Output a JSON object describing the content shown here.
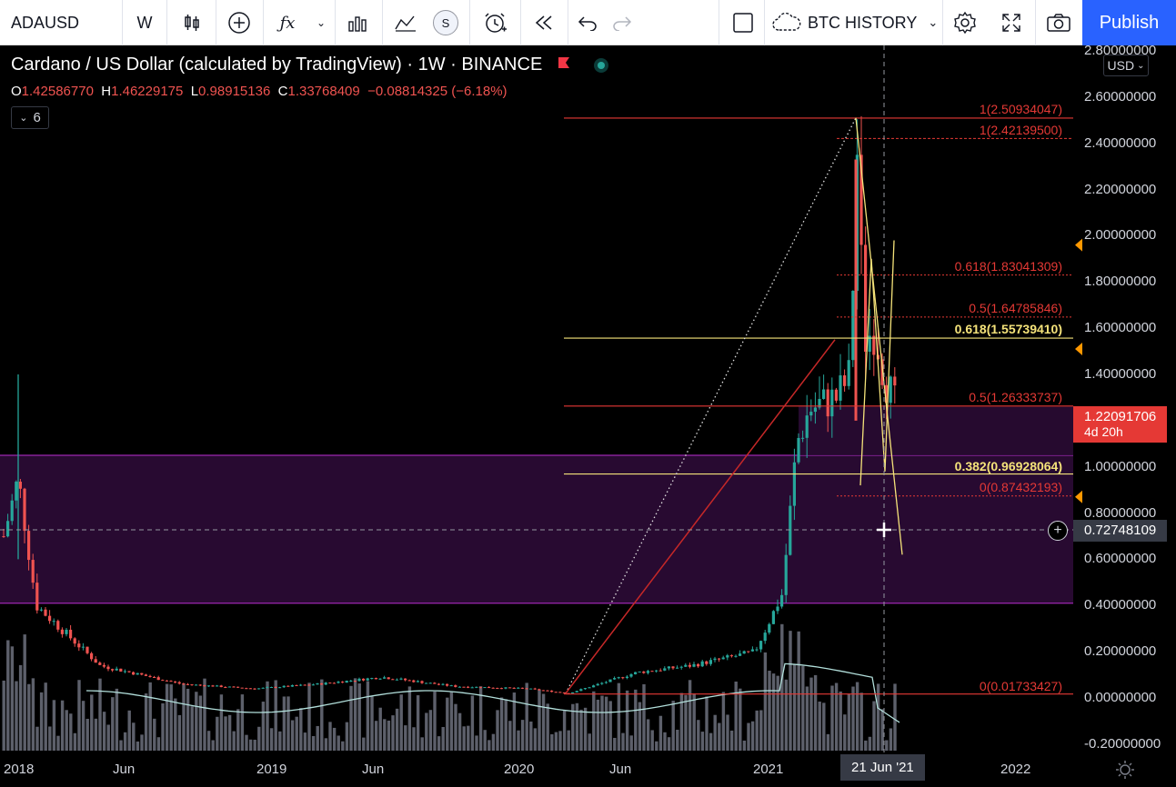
{
  "toolbar": {
    "symbol": "ADAUSD",
    "interval": "W",
    "indicator_fx": "ƒx",
    "replay_s": "S",
    "layout_name": "BTC HISTORY",
    "publish_label": "Publish"
  },
  "legend": {
    "title": "Cardano / US Dollar (calculated by TradingView) · 1W · BINANCE",
    "o_key": "O",
    "o": "1.42586770",
    "h_key": "H",
    "h": "1.46229175",
    "l_key": "L",
    "l": "0.98915136",
    "c_key": "C",
    "c": "1.33768409",
    "change": "−0.08814325 (−6.18%)",
    "indicators_count": "6"
  },
  "price_axis": {
    "currency": "USD",
    "ticks": [
      "2.80000000",
      "2.60000000",
      "2.40000000",
      "2.20000000",
      "2.00000000",
      "1.80000000",
      "1.60000000",
      "1.40000000",
      "1.20000000",
      "1.00000000",
      "0.80000000",
      "0.60000000",
      "0.40000000",
      "0.20000000",
      "0.00000000",
      "-0.20000000"
    ],
    "last_price": "1.22091706",
    "countdown": "4d 20h",
    "crosshair_price": "0.72748109"
  },
  "time_axis": {
    "ticks": [
      "2018",
      "Jun",
      "2019",
      "Jun",
      "2020",
      "Jun",
      "2021",
      "21 Jun '21",
      "2022"
    ]
  },
  "fib_labels": {
    "l1": "1(2.50934047)",
    "l2": "1(2.42139500)",
    "l3": "0.618(1.83041309)",
    "l4": "0.5(1.64785846)",
    "l5": "0.618(1.55739410)",
    "l6": "0.5(1.26333737)",
    "l7": "0.382(0.96928064)",
    "l8": "0(0.87432193)",
    "l9": "0(0.01733427)"
  },
  "colors": {
    "up": "#26a69a",
    "down": "#ef5350",
    "fib_red": "#e53935",
    "fib_yellow": "#f5e37a",
    "zone": "#9c27b0",
    "accent": "#2962ff"
  },
  "chart_data": {
    "type": "candlestick",
    "symbol": "ADAUSD",
    "interval": "1W",
    "ylim": [
      -0.2,
      2.8
    ],
    "points": [
      [
        "2018-01",
        0.7,
        1.05,
        0.6,
        0.88
      ],
      [
        "2018-03",
        0.3,
        0.4,
        0.2,
        0.24
      ],
      [
        "2018-06",
        0.14,
        0.15,
        0.11,
        0.12
      ],
      [
        "2018-09",
        0.08,
        0.09,
        0.06,
        0.07
      ],
      [
        "2019-01",
        0.04,
        0.05,
        0.03,
        0.04
      ],
      [
        "2019-06",
        0.08,
        0.09,
        0.07,
        0.08
      ],
      [
        "2019-10",
        0.04,
        0.05,
        0.03,
        0.04
      ],
      [
        "2020-03",
        0.03,
        0.04,
        0.02,
        0.03
      ],
      [
        "2020-08",
        0.12,
        0.15,
        0.1,
        0.13
      ],
      [
        "2020-12",
        0.18,
        0.2,
        0.15,
        0.18
      ],
      [
        "2021-02",
        0.7,
        1.1,
        0.6,
        1.05
      ],
      [
        "2021-03",
        1.15,
        1.48,
        1.0,
        1.25
      ],
      [
        "2021-05",
        1.65,
        2.46,
        1.4,
        2.0
      ],
      [
        "2021-06",
        1.45,
        1.55,
        1.2,
        1.42
      ],
      [
        "2021-07",
        1.43,
        1.46,
        0.99,
        1.34
      ]
    ]
  }
}
